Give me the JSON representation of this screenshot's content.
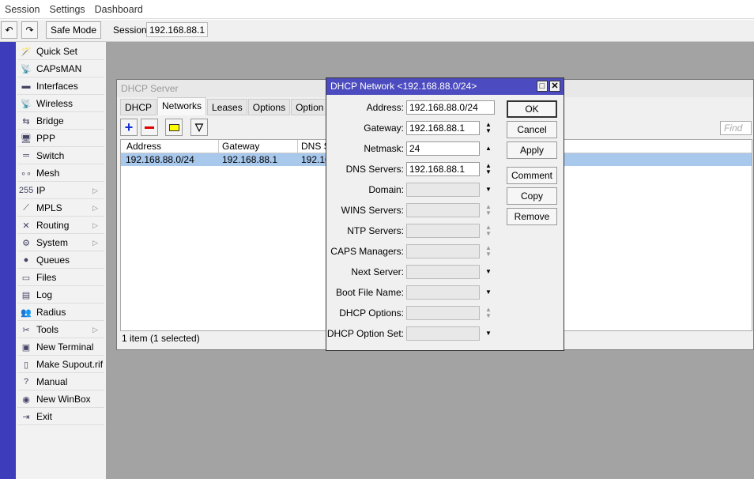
{
  "menu": [
    "Session",
    "Settings",
    "Dashboard"
  ],
  "toolbar": {
    "undo": "undo-icon",
    "redo": "redo-icon",
    "safe_mode": "Safe Mode",
    "session_label": "Session:",
    "session_value": "192.168.88.1"
  },
  "sidebar": [
    {
      "label": "Quick Set",
      "icon": "🪄"
    },
    {
      "label": "CAPsMAN",
      "icon": "📡"
    },
    {
      "label": "Interfaces",
      "icon": "▬"
    },
    {
      "label": "Wireless",
      "icon": "📡"
    },
    {
      "label": "Bridge",
      "icon": "⇆"
    },
    {
      "label": "PPP",
      "icon": "🖥"
    },
    {
      "label": "Switch",
      "icon": "═"
    },
    {
      "label": "Mesh",
      "icon": "∘∘"
    },
    {
      "label": "IP",
      "icon": "255",
      "sub": true
    },
    {
      "label": "MPLS",
      "icon": "⟋",
      "sub": true
    },
    {
      "label": "Routing",
      "icon": "✕",
      "sub": true
    },
    {
      "label": "System",
      "icon": "⚙",
      "sub": true
    },
    {
      "label": "Queues",
      "icon": "●"
    },
    {
      "label": "Files",
      "icon": "▭"
    },
    {
      "label": "Log",
      "icon": "▤"
    },
    {
      "label": "Radius",
      "icon": "👥"
    },
    {
      "label": "Tools",
      "icon": "✂",
      "sub": true
    },
    {
      "label": "New Terminal",
      "icon": "▣"
    },
    {
      "label": "Make Supout.rif",
      "icon": "▯"
    },
    {
      "label": "Manual",
      "icon": "?"
    },
    {
      "label": "New WinBox",
      "icon": "◉"
    },
    {
      "label": "Exit",
      "icon": "⇥"
    }
  ],
  "dhcp_server": {
    "title": "DHCP Server",
    "tabs": [
      "DHCP",
      "Networks",
      "Leases",
      "Options",
      "Option Sets"
    ],
    "active_tab": "Networks",
    "find_placeholder": "Find",
    "columns": [
      "Address",
      "Gateway",
      "DNS S..."
    ],
    "rows": [
      [
        "192.168.88.0/24",
        "192.168.88.1",
        "192.16..."
      ]
    ],
    "status": "1 item (1 selected)"
  },
  "dialog": {
    "title": "DHCP Network <192.168.88.0/24>",
    "fields": [
      {
        "label": "Address:",
        "value": "192.168.88.0/24"
      },
      {
        "label": "Gateway:",
        "value": "192.168.88.1"
      },
      {
        "label": "Netmask:",
        "value": "24"
      },
      {
        "label": "DNS Servers:",
        "value": "192.168.88.1"
      },
      {
        "label": "Domain:",
        "value": ""
      },
      {
        "label": "WINS Servers:",
        "value": ""
      },
      {
        "label": "NTP Servers:",
        "value": ""
      },
      {
        "label": "CAPS Managers:",
        "value": ""
      },
      {
        "label": "Next Server:",
        "value": ""
      },
      {
        "label": "Boot File Name:",
        "value": ""
      },
      {
        "label": "DHCP Options:",
        "value": ""
      },
      {
        "label": "DHCP Option Set:",
        "value": ""
      }
    ],
    "buttons": [
      "OK",
      "Cancel",
      "Apply",
      "Comment",
      "Copy",
      "Remove"
    ]
  },
  "colors": {
    "accent": "#4c4cc0",
    "selection": "#a8c8ec"
  }
}
